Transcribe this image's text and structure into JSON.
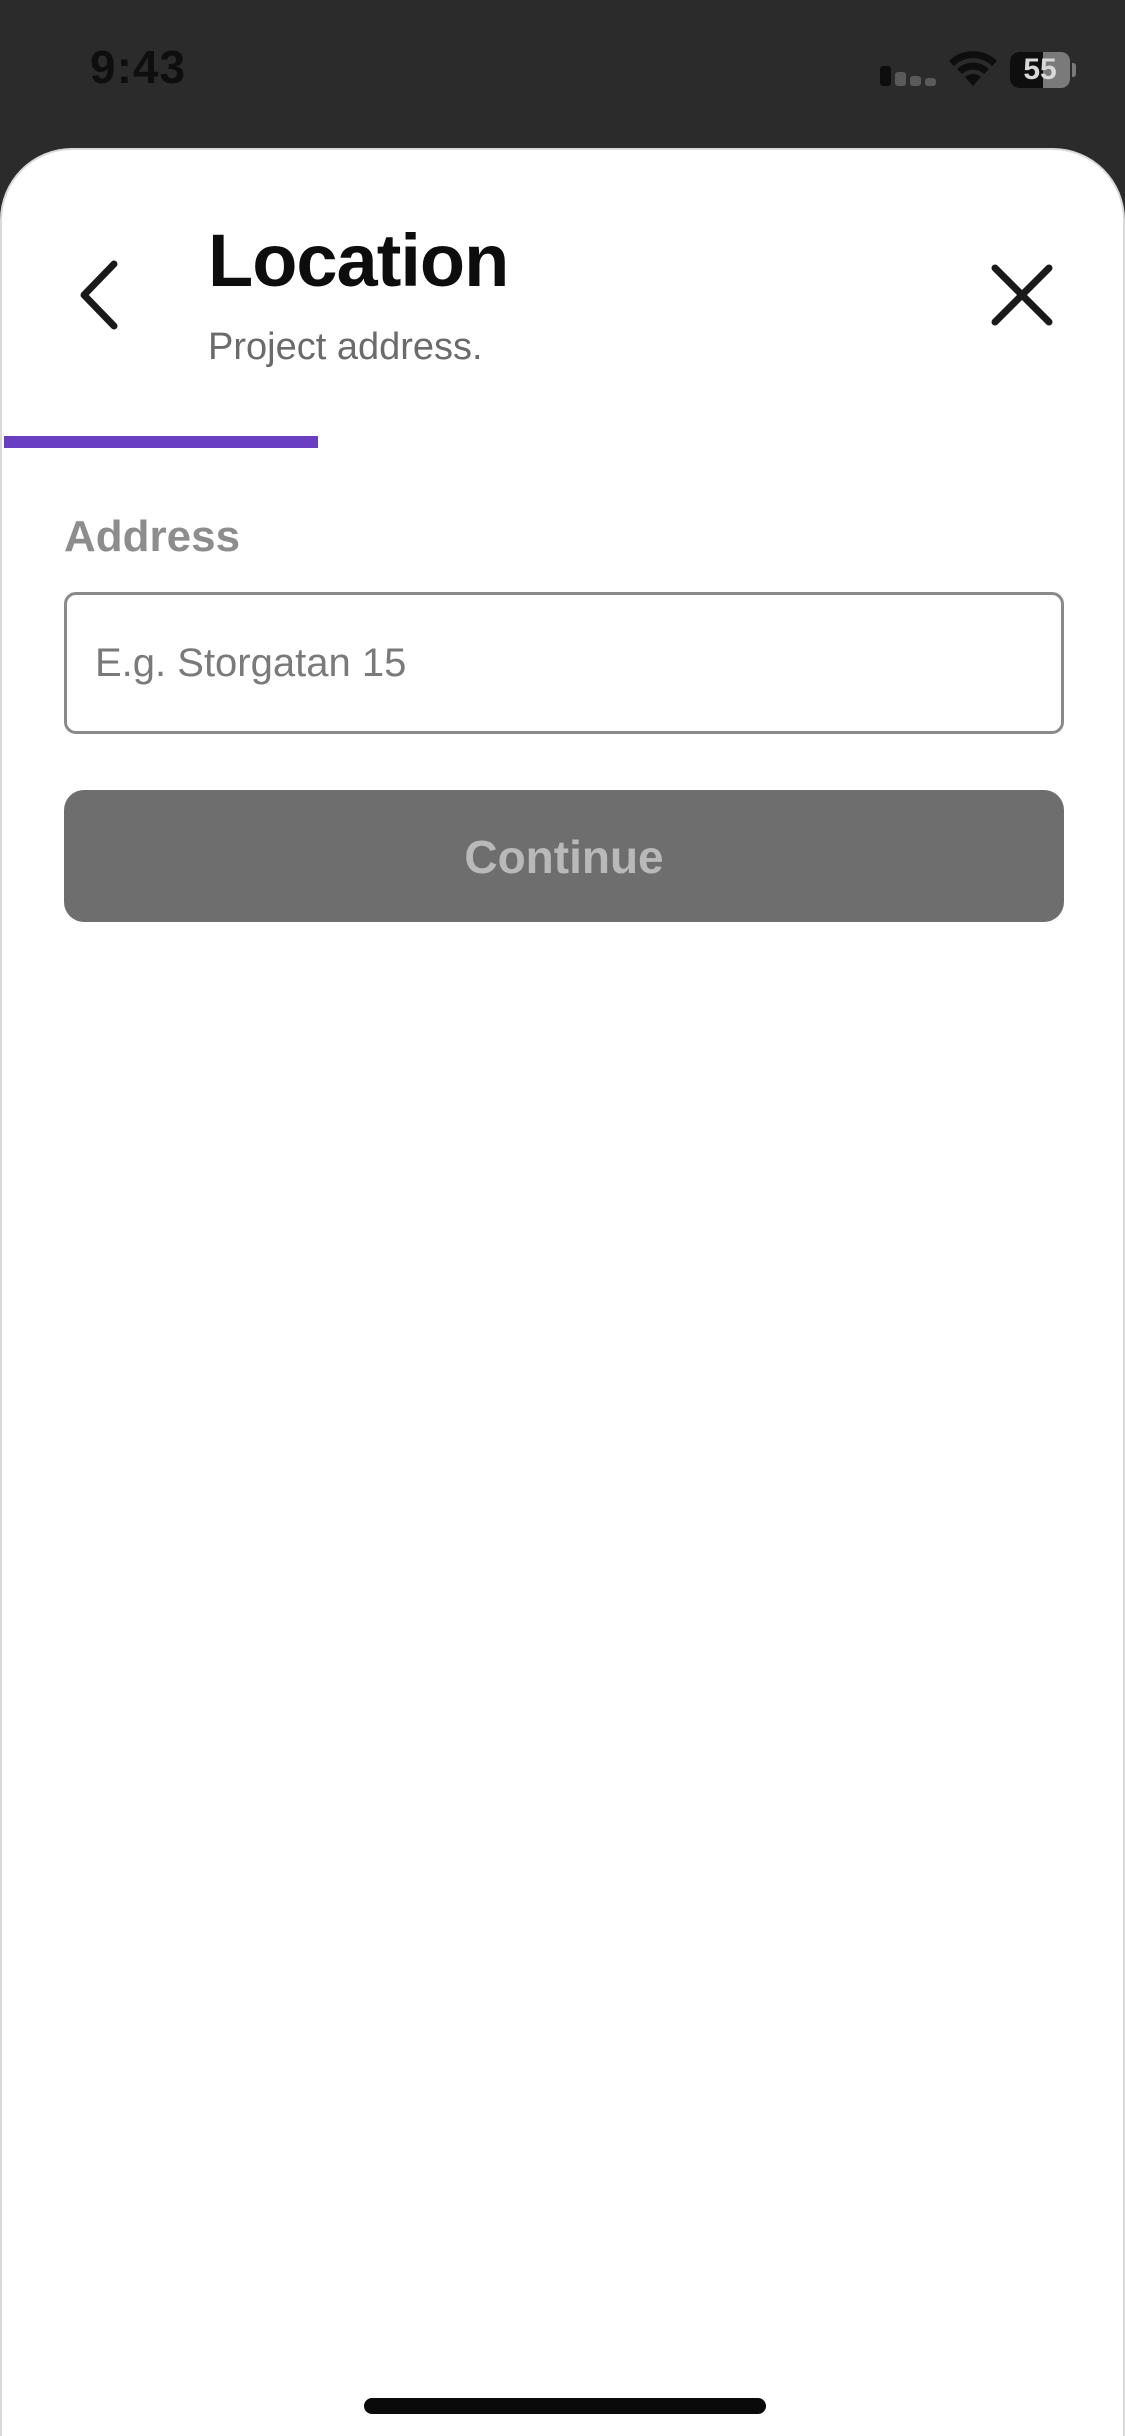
{
  "status_bar": {
    "time": "9:43",
    "battery_label": "55",
    "battery_level": 0.55,
    "icons": [
      "signal-icon",
      "wifi-icon",
      "battery-icon"
    ]
  },
  "header": {
    "title": "Location",
    "subtitle": "Project address.",
    "back_icon": "chevron-left-icon",
    "close_icon": "close-icon"
  },
  "progress": {
    "fraction": 0.28,
    "color": "#6a3ec1"
  },
  "form": {
    "address_label": "Address",
    "address_placeholder": "E.g. Storgatan 15",
    "address_value": "",
    "continue_label": "Continue"
  },
  "colors": {
    "status_bar_bg": "#2b2b2b",
    "sheet_bg": "#ffffff",
    "button_disabled_bg": "#6e6e6e",
    "button_disabled_text": "#b9b9b9"
  }
}
